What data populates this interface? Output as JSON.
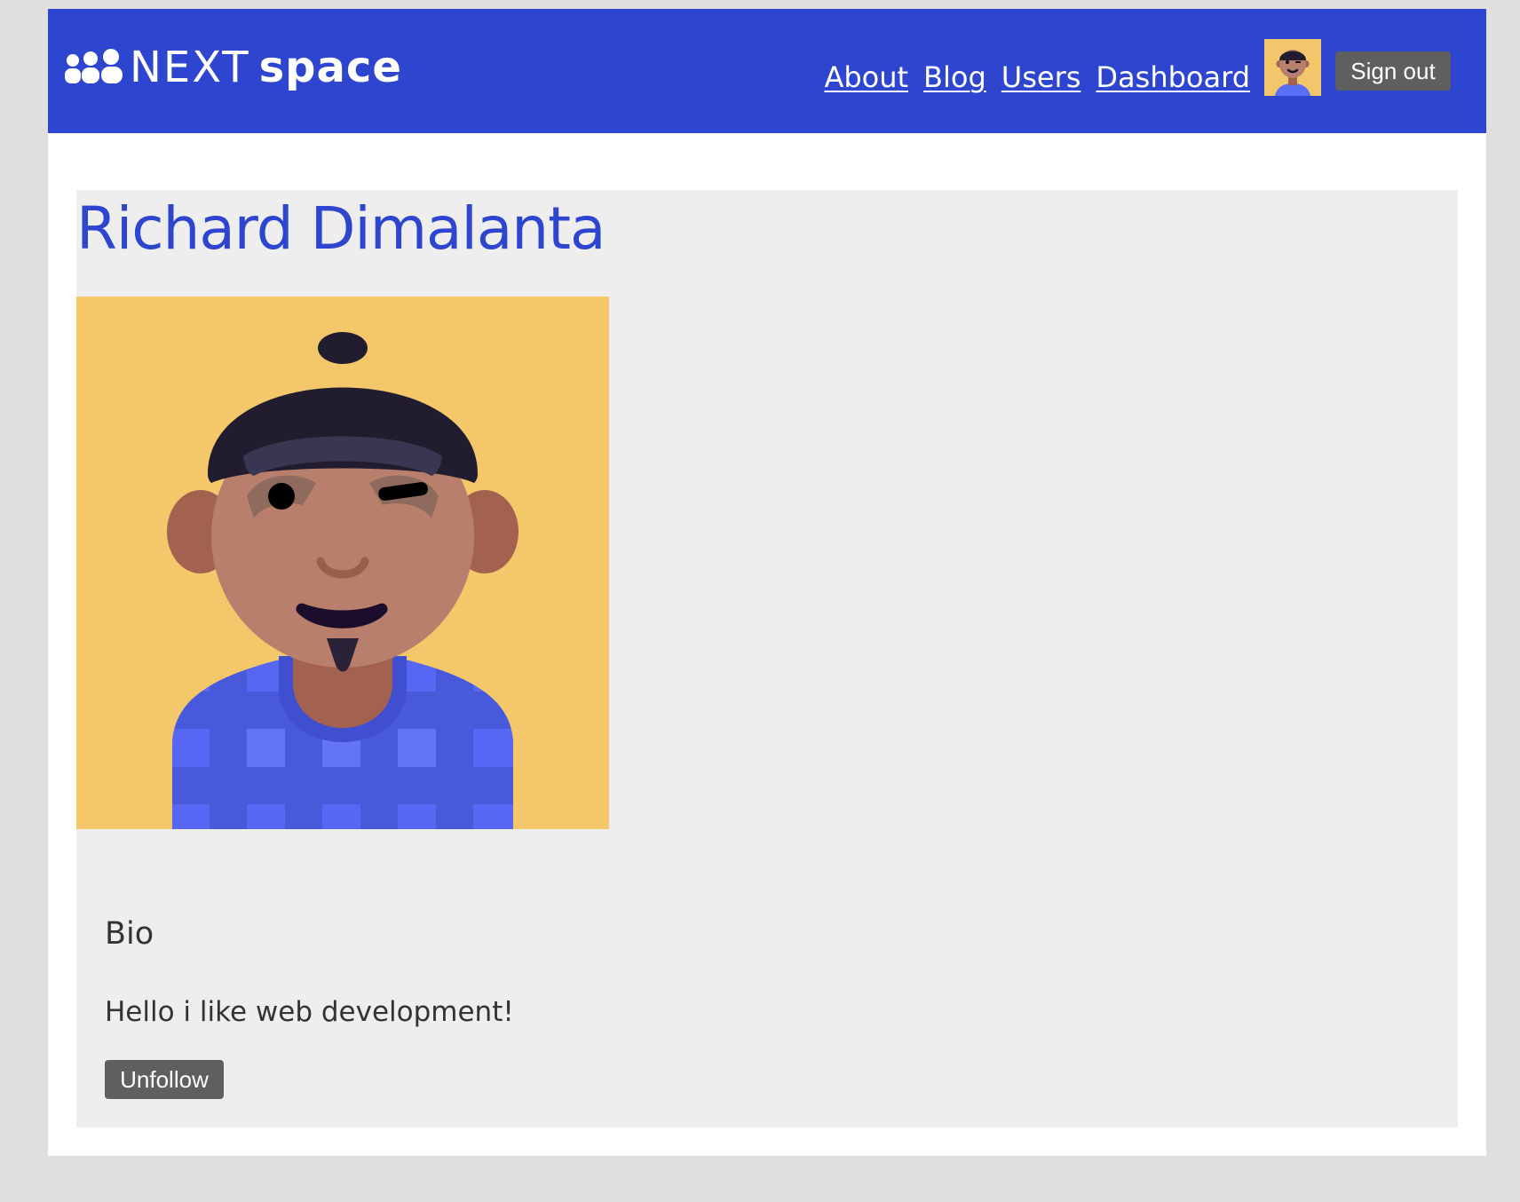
{
  "header": {
    "logo": {
      "text_a": "NEXT",
      "text_b": "space",
      "icon": "users-group-icon"
    },
    "nav_links": [
      {
        "label": "About"
      },
      {
        "label": "Blog"
      },
      {
        "label": "Users"
      },
      {
        "label": "Dashboard"
      }
    ],
    "avatar": {
      "icon": "user-avatar-icon"
    },
    "sign_out_label": "Sign out",
    "color": "#2e45cf"
  },
  "profile": {
    "name": "Richard Dimalanta",
    "image": "user-avatar-illustration",
    "bio_heading": "Bio",
    "bio_text": "Hello i like web development!",
    "unfollow_label": "Unfollow"
  },
  "colors": {
    "accent": "#2e45cf",
    "page_bg": "#dfdfdf",
    "card_bg": "#eeeeee",
    "button_bg": "#5f5f5f",
    "avatar_bg": "#f4c76a"
  }
}
